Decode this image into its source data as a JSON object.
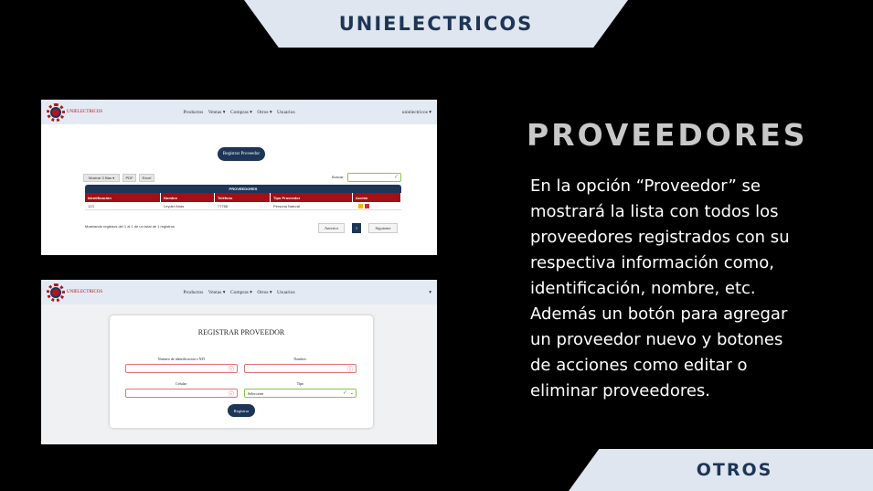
{
  "banner_top": "UNIELECTRICOS",
  "banner_bottom": "OTROS",
  "section": {
    "title": "PROVEEDORES",
    "body": "En la opción “Proveedor” se mostrará la lista con todos los proveedores registrados con su respectiva información como, identificación, nombre, etc. Además un botón para agregar un proveedor nuevo y botones de acciones como editar o eliminar proveedores."
  },
  "nav": {
    "logo_text": "UNIELECTRICOS",
    "items": [
      "Productos",
      "Ventas ▾",
      "Compras ▾",
      "Otros ▾",
      "Usuarios"
    ],
    "user": "unielectricos ▾",
    "user2": "▾"
  },
  "list": {
    "register_button": "Registrar Proveedor",
    "show_rows": "Mostrar 3 filas ▾",
    "pdf": "PDF",
    "excel": "Excel",
    "search_label": "Buscar:",
    "table_title": "PROVEEDORES",
    "columns": [
      "Identificación",
      "Nombre",
      "Teléfono",
      "Tipo Proveedor",
      "Acción"
    ],
    "rows": [
      {
        "id": "123",
        "nombre": "Leyder Arias",
        "telefono": "77788",
        "tipo": "Persona Natural"
      }
    ],
    "footer_info": "Mostrando registros del 1 al 1 de un total de 1 registros",
    "prev": "Anterior",
    "page": "1",
    "next": "Siguiente"
  },
  "form": {
    "title": "REGISTRAR PROVEEDOR",
    "id_label": "Numero de identificacion o NIT",
    "name_label": "Nombre:",
    "phone_label": "Celular:",
    "type_label": "Tipo",
    "type_value": "Seleccione",
    "submit": "Registrar"
  },
  "colors": {
    "navy": "#1d3557",
    "red": "#a40e14",
    "banner": "#dfe6ef"
  }
}
